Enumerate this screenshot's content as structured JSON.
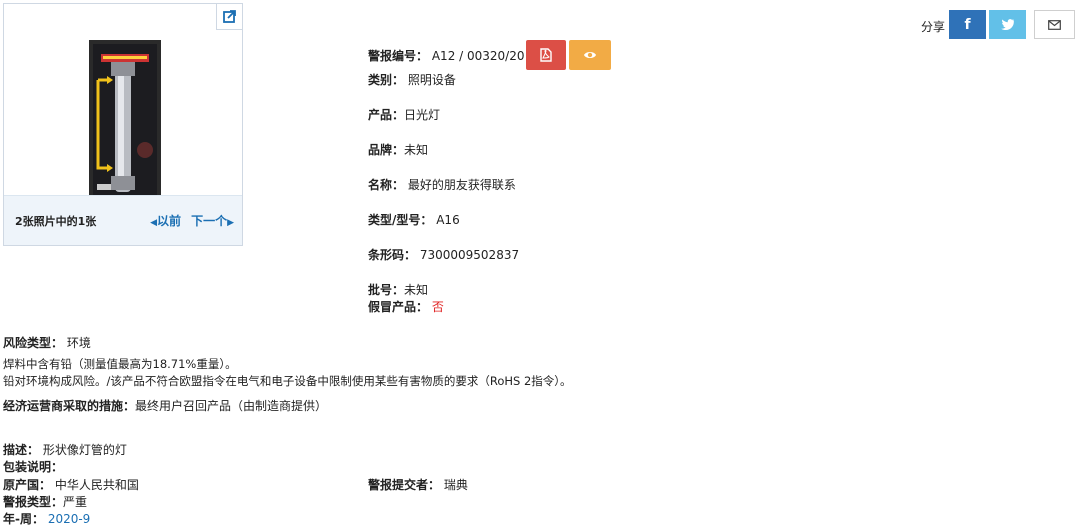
{
  "gallery": {
    "counter": "2张照片中的1张",
    "prev": "以前",
    "next": "下一个"
  },
  "alert": {
    "number_label": "警报编号：",
    "number_value": "A12 / 00320/20",
    "category_label": "类别：",
    "category_value": "照明设备",
    "product_label": "产品：",
    "product_value": "日光灯",
    "brand_label": "品牌：",
    "brand_value": "未知",
    "name_label": "名称：",
    "name_value": "最好的朋友获得联系",
    "model_label": "类型/型号：",
    "model_value": "A16",
    "barcode_label": "条形码：",
    "barcode_value": "7300009502837",
    "batch_label": "批号：",
    "batch_value": "未知",
    "counterfeit_label": "假冒产品：",
    "counterfeit_value": "否"
  },
  "share": {
    "label": "分享"
  },
  "risk": {
    "type_label": "风险类型：",
    "type_value": "环境",
    "line1": "焊料中含有铅（测量值最高为18.71%重量）。",
    "line2": "铅对环境构成风险。/该产品不符合欧盟指令在电气和电子设备中限制使用某些有害物质的要求（RoHS 2指令）。",
    "measures_label": "经济运营商采取的措施：",
    "measures_value": "最终用户召回产品（由制造商提供）"
  },
  "info": {
    "description_label": "描述：",
    "description_value": "形状像灯管的灯",
    "packaging_label": "包装说明：",
    "packaging_value": "",
    "origin_label": "原产国：",
    "origin_value": "中华人民共和国",
    "submitter_label": "警报提交者：",
    "submitter_value": "瑞典",
    "alert_type_label": "警报类型：",
    "alert_type_value": "严重",
    "week_label": "年-周：",
    "week_value": "2020-9"
  },
  "colors": {
    "accent_blue": "#1b6fb3",
    "pdf_red": "#dc4f46",
    "eye_orange": "#f2ab45",
    "facebook": "#2f72b8",
    "twitter": "#62c0e8"
  }
}
